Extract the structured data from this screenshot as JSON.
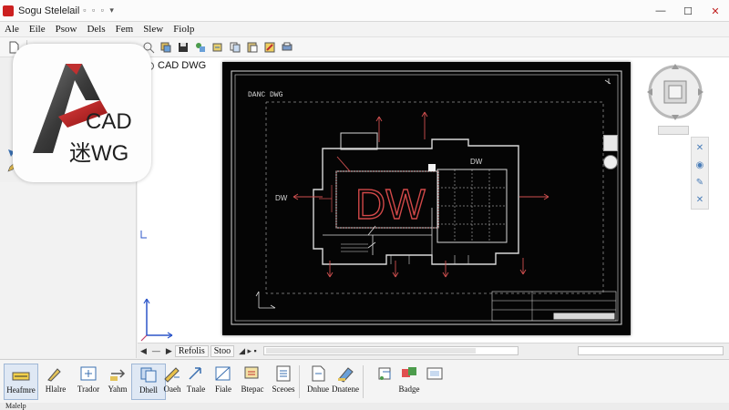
{
  "window": {
    "title": "Sogu Stelelail",
    "quick_access": "▫ ▫ ▫ ▾",
    "min_label": "—",
    "max_label": "☐",
    "close_label": "✕"
  },
  "menu": [
    "Ale",
    "Eile",
    "Psow",
    "Dels",
    "Fem",
    "Slew",
    "Fiolp"
  ],
  "logo": {
    "top_text": "CAD",
    "bottom_text": "迷WG"
  },
  "drawing": {
    "tab_label": "CAD DWG"
  },
  "cad": {
    "sheet_title": "DANC DWG",
    "big_label": "DW",
    "left_label": "DW",
    "room_label": "DW"
  },
  "tabbar": {
    "prev": "◀",
    "line1": "—",
    "next": "▶",
    "tab1": "Refolis",
    "tab2": "Stoo",
    "mark": "◢ ▸ ▪"
  },
  "ribbon": {
    "buttons": [
      {
        "label": "Heafmre",
        "icon": "highlight-icon"
      },
      {
        "label": "Hlalre",
        "icon": "draw-icon"
      },
      {
        "label": "Trador",
        "icon": "trace-icon"
      },
      {
        "label": "Yahm",
        "icon": "move-icon"
      },
      {
        "label": "Dhell",
        "icon": "copy-icon"
      },
      {
        "label": "Oaeh",
        "icon": "pencil-icon"
      },
      {
        "label": "Tnale",
        "icon": "transform-icon"
      },
      {
        "label": "Fiale",
        "icon": "scale-icon"
      },
      {
        "label": "Btepac",
        "icon": "block-icon"
      },
      {
        "label": "Sceoes",
        "icon": "sheet-icon"
      },
      {
        "label": "Dnhue",
        "icon": "document-icon"
      },
      {
        "label": "Dnatene",
        "icon": "erase-icon"
      },
      {
        "label": "Badge",
        "icon": "badge-icon"
      }
    ]
  },
  "status": {
    "text": "Malelp"
  },
  "colors": {
    "canvas_bg": "#050505",
    "line": "#d8d8d8",
    "accent_red": "#d05050",
    "title_red": "#cc2020"
  }
}
